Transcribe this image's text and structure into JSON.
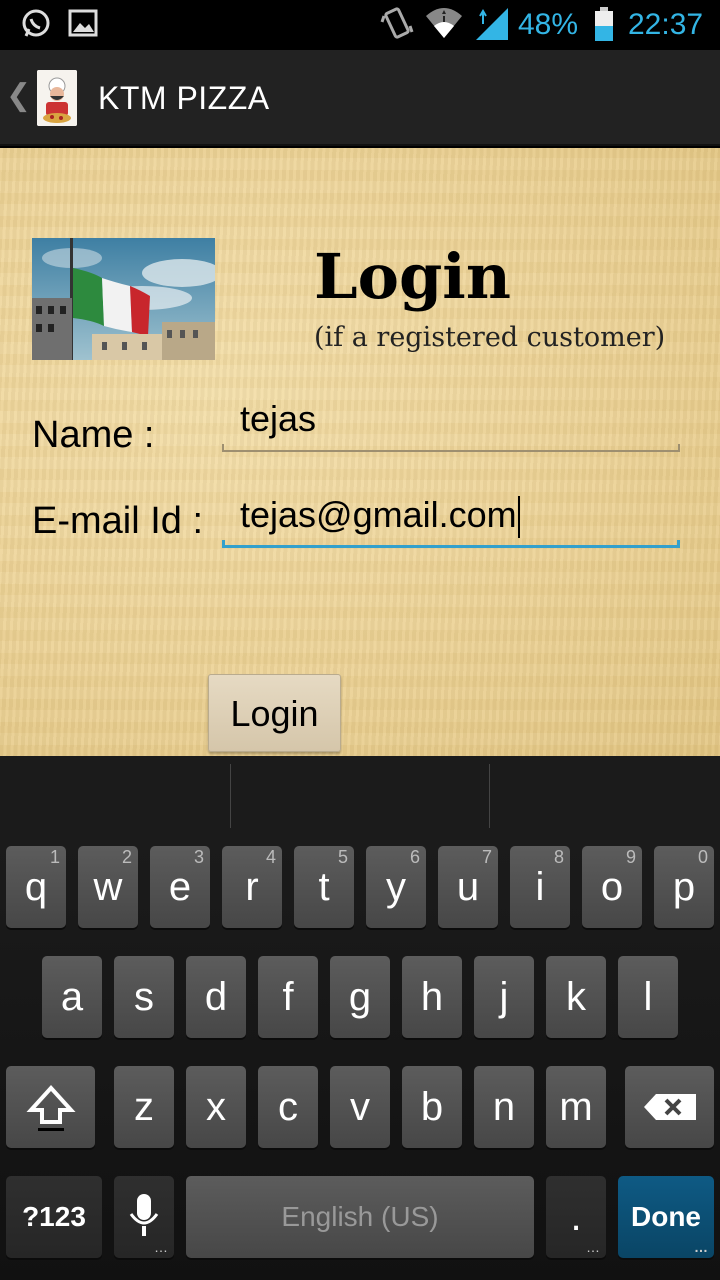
{
  "status_bar": {
    "battery": "48%",
    "time": "22:37",
    "icons": [
      "whatsapp-icon",
      "gallery-icon",
      "vibrate-icon",
      "wifi-icon",
      "signal-icon",
      "battery-icon"
    ]
  },
  "action_bar": {
    "title": "KTM PIZZA",
    "back_glyph": "❮"
  },
  "form": {
    "heading": "Login",
    "subheading": "(if a registered customer)",
    "name_label": "Name :",
    "name_value": "tejas",
    "email_label": "E-mail Id :",
    "email_value": "tejas@gmail.com",
    "login_button": "Login"
  },
  "keyboard": {
    "row1": [
      [
        "q",
        "1"
      ],
      [
        "w",
        "2"
      ],
      [
        "e",
        "3"
      ],
      [
        "r",
        "4"
      ],
      [
        "t",
        "5"
      ],
      [
        "y",
        "6"
      ],
      [
        "u",
        "7"
      ],
      [
        "i",
        "8"
      ],
      [
        "o",
        "9"
      ],
      [
        "p",
        "0"
      ]
    ],
    "row2": [
      "a",
      "s",
      "d",
      "f",
      "g",
      "h",
      "j",
      "k",
      "l"
    ],
    "row3": [
      "z",
      "x",
      "c",
      "v",
      "b",
      "n",
      "m"
    ],
    "symbols_key": "?123",
    "space_label": "English (US)",
    "period_key": ".",
    "done_key": "Done"
  },
  "colors": {
    "accent": "#33b5e5",
    "field_focus": "#33a0cc",
    "done_key": "#0e5a84"
  }
}
